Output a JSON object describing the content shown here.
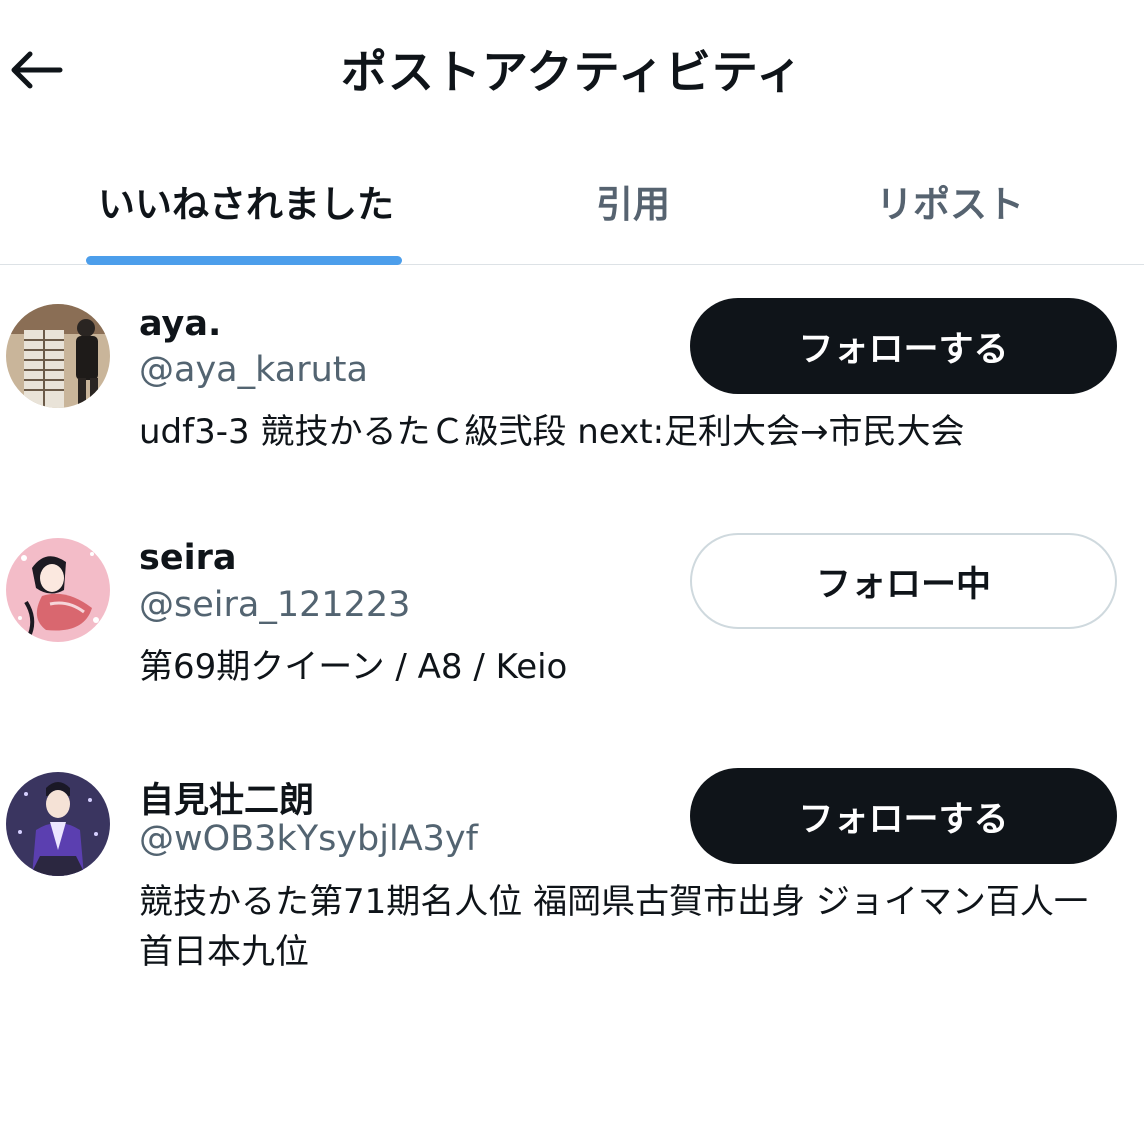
{
  "header": {
    "title": "ポストアクティビティ",
    "back_icon": "arrow-left-icon"
  },
  "tabs": [
    {
      "label": "いいねされました",
      "active": true
    },
    {
      "label": "引用",
      "active": false
    },
    {
      "label": "リポスト",
      "active": false
    }
  ],
  "colors": {
    "accent": "#4c9eeb",
    "primary_text": "#0f1419",
    "secondary_text": "#536471",
    "follow_button_bg": "#0f1419",
    "following_border": "#cfd9de"
  },
  "users": [
    {
      "name": "aya.",
      "handle": "@aya_karuta",
      "bio": "udf3-3 競技かるたＣ級弐段 next:足利大会→市民大会",
      "button_label": "フォローする",
      "button_state": "follow"
    },
    {
      "name": "seira",
      "handle": "@seira_121223",
      "bio": "第69期クイーン / A8 / Keio",
      "button_label": "フォロー中",
      "button_state": "following"
    },
    {
      "name": "自見壮二朗",
      "handle": "@wOB3kYsybjlA3yf",
      "bio": "競技かるた第71期名人位 福岡県古賀市出身 ジョイマン百人一首日本九位",
      "button_label": "フォローする",
      "button_state": "follow"
    }
  ]
}
